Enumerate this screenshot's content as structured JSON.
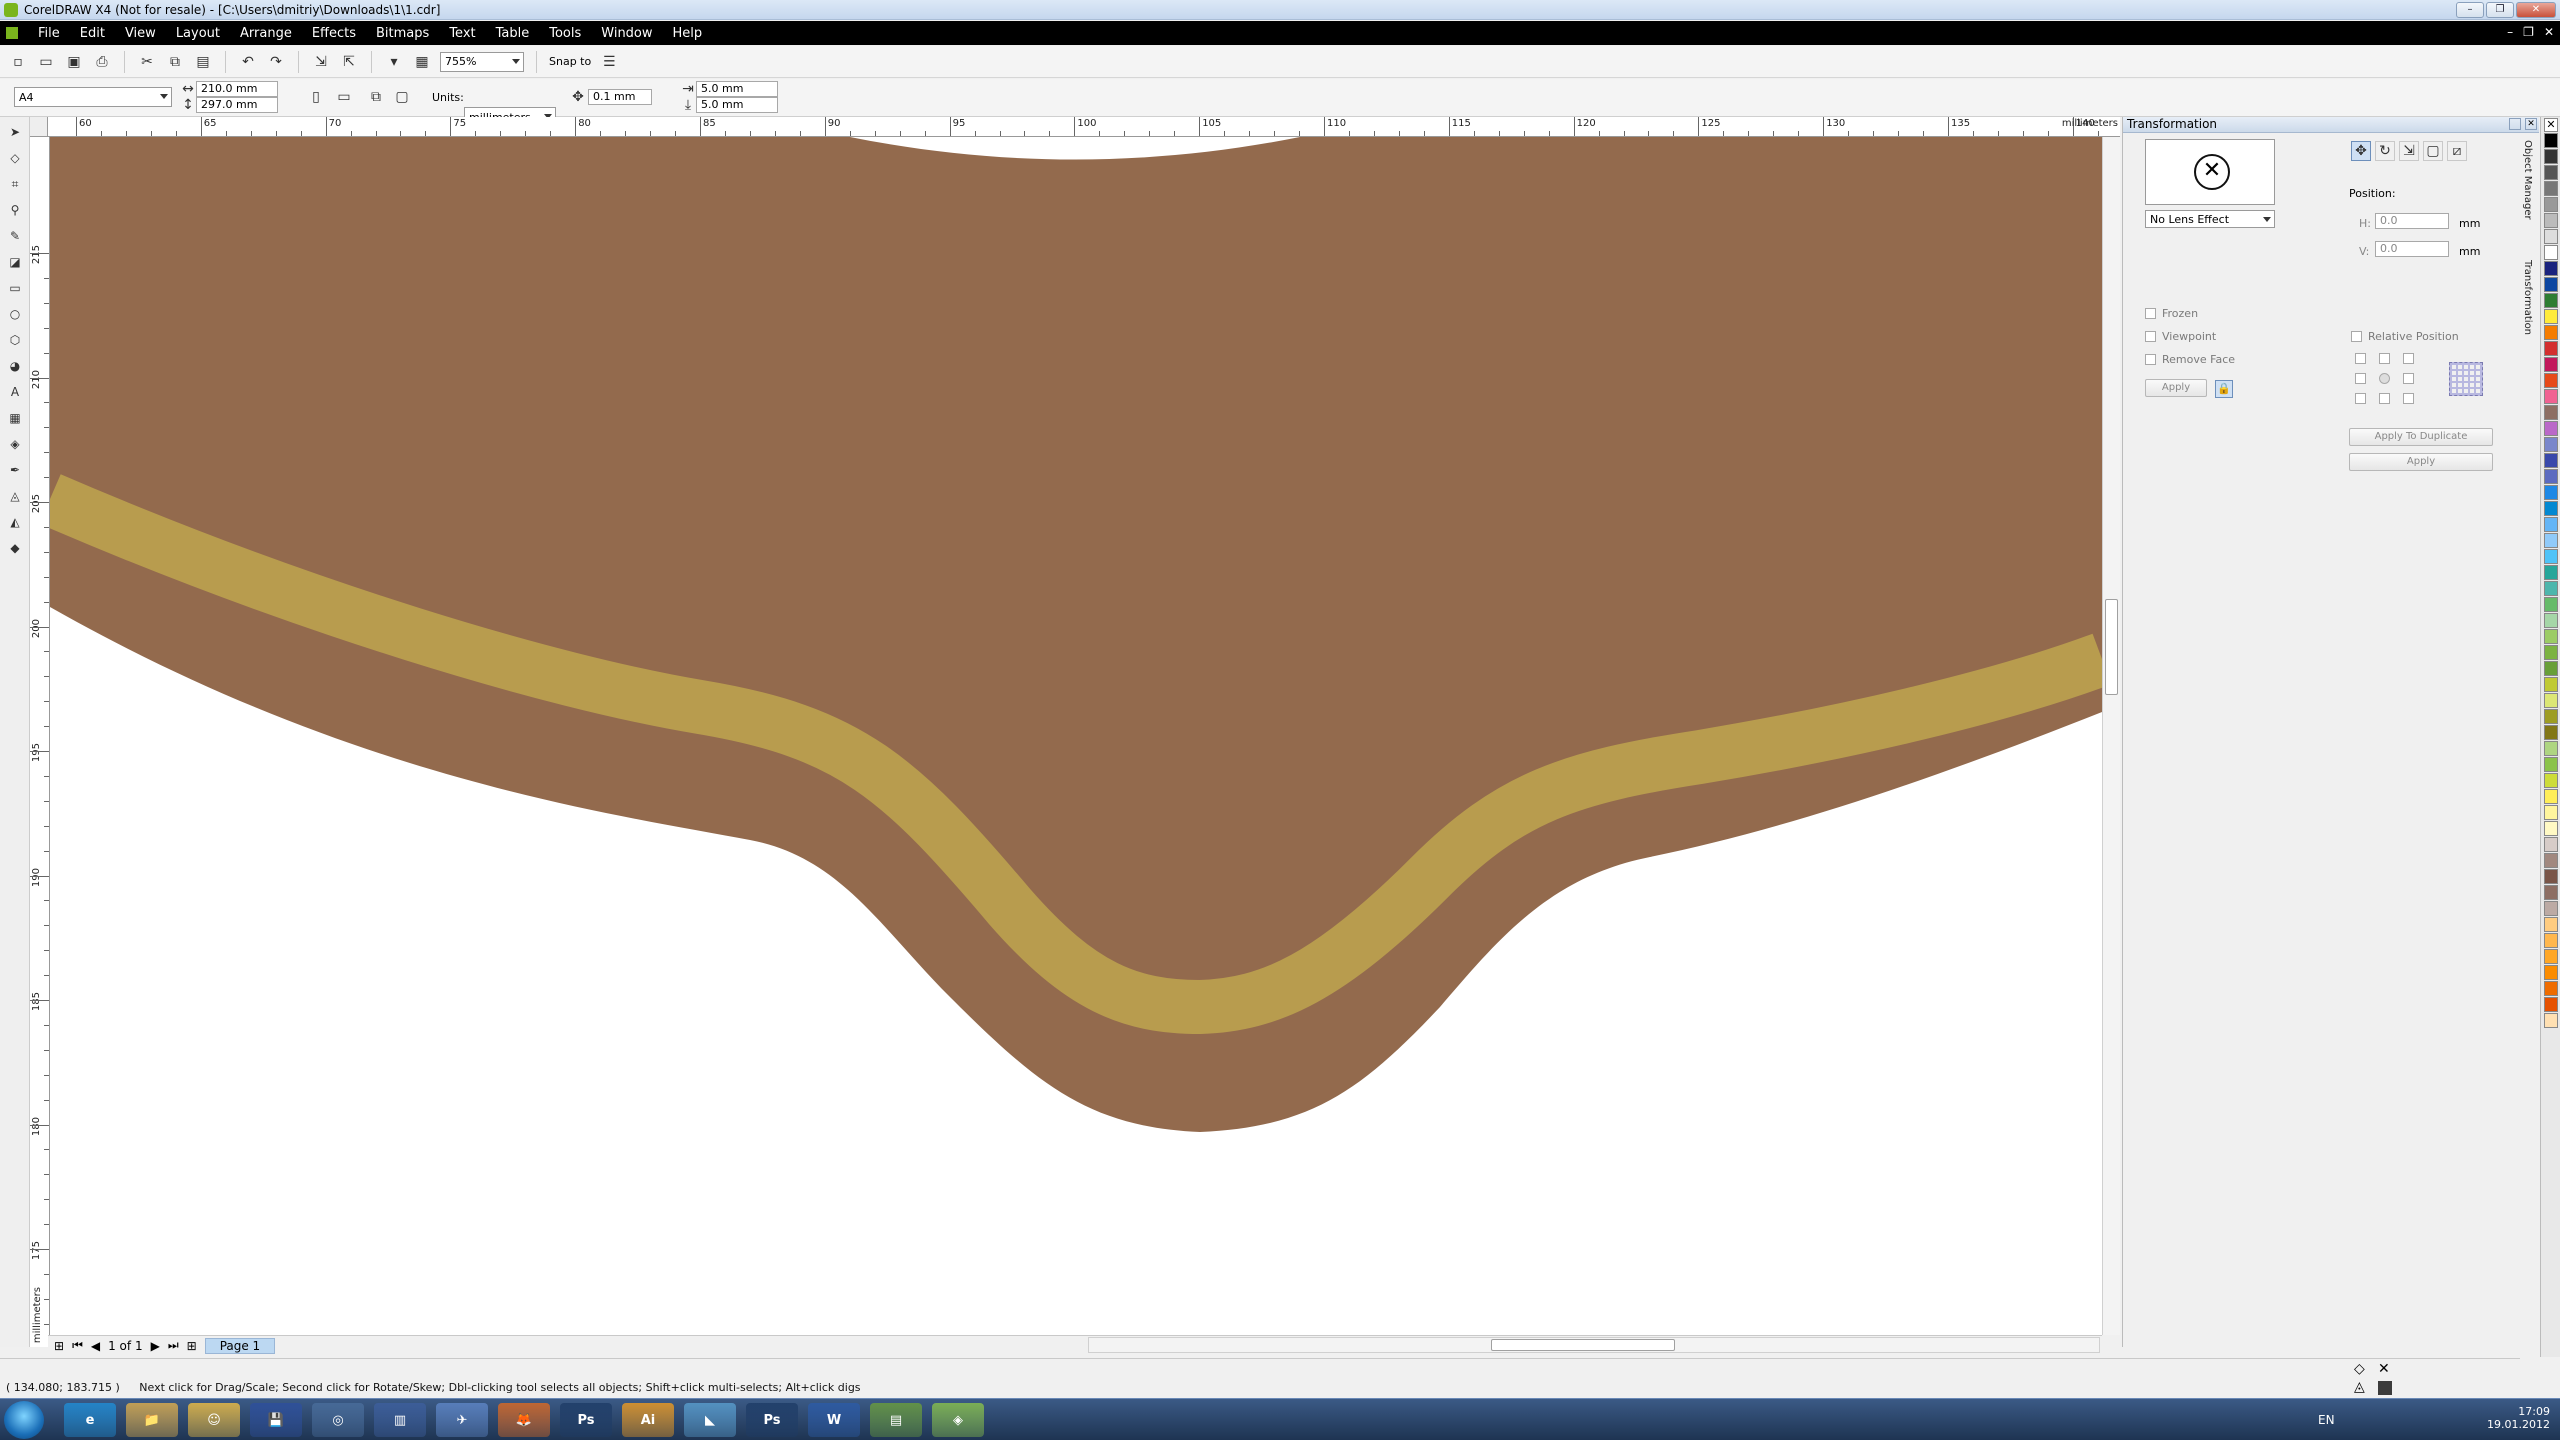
{
  "window": {
    "title": "CorelDRAW X4 (Not for resale) - [C:\\Users\\dmitriy\\Downloads\\1\\1.cdr]",
    "controls": [
      "–",
      "❐",
      "✕"
    ]
  },
  "menu": {
    "items": [
      "File",
      "Edit",
      "View",
      "Layout",
      "Arrange",
      "Effects",
      "Bitmaps",
      "Text",
      "Table",
      "Tools",
      "Window",
      "Help"
    ],
    "doc_controls": [
      "–",
      "❐",
      "✕"
    ]
  },
  "standard_toolbar": {
    "zoom": "755%",
    "snap_to": "Snap to"
  },
  "property_bar": {
    "page_size": "A4",
    "width": "210.0 mm",
    "height": "297.0 mm",
    "units_label": "Units:",
    "units": "millimeters",
    "nudge": "0.1 mm",
    "dup_x": "5.0 mm",
    "dup_y": "5.0 mm"
  },
  "ruler": {
    "units_label": "millimeters",
    "h_labels": [
      "60",
      "65",
      "70",
      "75",
      "80",
      "85",
      "90",
      "95",
      "100",
      "105",
      "110",
      "115",
      "120",
      "125",
      "130",
      "135",
      "140"
    ],
    "v_labels": [
      "215",
      "210",
      "205",
      "200",
      "195",
      "190",
      "185",
      "180",
      "175"
    ],
    "v_units": "millimeters"
  },
  "page_nav": {
    "count": "1 of 1",
    "tab": "Page 1"
  },
  "status": {
    "coords": "( 134.080; 183.715 )",
    "hint": "Next click for Drag/Scale; Second click for Rotate/Skew; Dbl-clicking tool selects all objects; Shift+click multi-selects; Alt+click digs"
  },
  "docker": {
    "title": "Transformation",
    "lens_effect": "No Lens Effect",
    "position_label": "Position:",
    "h_label": "H:",
    "v_label": "V:",
    "h_value": "0.0",
    "v_value": "0.0",
    "unit": "mm",
    "frozen": "Frozen",
    "viewpoint": "Viewpoint",
    "remove_face": "Remove Face",
    "apply_small": "Apply",
    "relative_position": "Relative Position",
    "apply_to_duplicate": "Apply To Duplicate",
    "apply": "Apply",
    "tabs": [
      "Object Manager",
      "Transformation"
    ]
  },
  "colors": {
    "brown": "#936a4d",
    "gold": "#b89c4e",
    "taskbar": "#1e3452"
  },
  "palette": [
    "#000000",
    "#333333",
    "#555555",
    "#777777",
    "#999999",
    "#bbbbbb",
    "#dddddd",
    "#ffffff",
    "#1a237e",
    "#0d47a1",
    "#2e7d32",
    "#ffeb3b",
    "#f57c00",
    "#d32f2f",
    "#c2185b",
    "#e64a19",
    "#f06292",
    "#8d6e63",
    "#ba68c8",
    "#7986cb",
    "#3949ab",
    "#5c6bc0",
    "#1e88e5",
    "#0288d1",
    "#64b5f6",
    "#90caf9",
    "#4fc3f7",
    "#26a69a",
    "#4db6ac",
    "#66bb6a",
    "#a5d6a7",
    "#9ccc65",
    "#7cb342",
    "#689f38",
    "#c0ca33",
    "#dce775",
    "#9e9d24",
    "#827717",
    "#aed581",
    "#8bc34a",
    "#cddc39",
    "#ffee58",
    "#fff59d",
    "#fff9c4",
    "#d7ccc8",
    "#a1887f",
    "#795548",
    "#8d6e63",
    "#bcaaa4",
    "#ffcc80",
    "#ffb74d",
    "#ffa726",
    "#fb8c00",
    "#ef6c00",
    "#e65100",
    "#ffe0b2"
  ],
  "taskbar": {
    "apps": [
      "e",
      "📁",
      "☺",
      "💾",
      "◎",
      "▥",
      "✈",
      "🦊",
      "Ps",
      "Ai",
      "◣",
      "Ps",
      "W",
      "▤",
      "◈"
    ],
    "lang": "EN",
    "time": "17:09",
    "date": "19.01.2012"
  }
}
